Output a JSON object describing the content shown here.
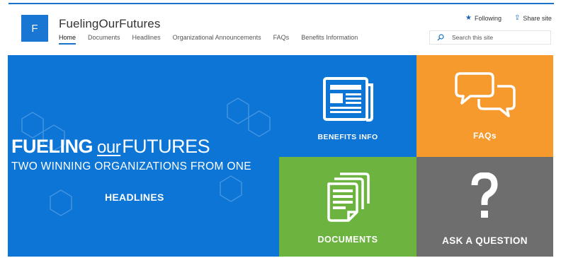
{
  "site": {
    "logo_letter": "F",
    "title": "FuelingOurFutures"
  },
  "nav": [
    {
      "label": "Home",
      "active": true
    },
    {
      "label": "Documents",
      "active": false
    },
    {
      "label": "Headlines",
      "active": false
    },
    {
      "label": "Organizational Announcements",
      "active": false
    },
    {
      "label": "FAQs",
      "active": false
    },
    {
      "label": "Benefits Information",
      "active": false
    }
  ],
  "actions": {
    "following_label": "Following",
    "following_icon": "star-icon",
    "share_label": "Share site",
    "share_icon": "share-icon"
  },
  "search": {
    "placeholder": "Search this site",
    "icon": "search-icon"
  },
  "hero": {
    "title_part1": "FUELING",
    "title_part2": "our",
    "title_part3": "FUTURES",
    "subtitle": "TWO WINNING ORGANIZATIONS FROM ONE",
    "link_label": "HEADLINES",
    "background_color": "#0c75d6"
  },
  "tiles": {
    "benefits": {
      "label": "BENEFITS INFO",
      "icon": "newspaper-icon",
      "color": "#0c75d6"
    },
    "faqs": {
      "label": "FAQs",
      "icon": "speech-bubbles-icon",
      "color": "#f79a2e"
    },
    "documents": {
      "label": "DOCUMENTS",
      "icon": "documents-icon",
      "color": "#6db33f"
    },
    "ask": {
      "label": "ASK A QUESTION",
      "icon": "question-mark-icon",
      "color": "#6e6e6e"
    }
  },
  "colors": {
    "accent": "#1a73c7",
    "logo_bg": "#1976d2"
  }
}
